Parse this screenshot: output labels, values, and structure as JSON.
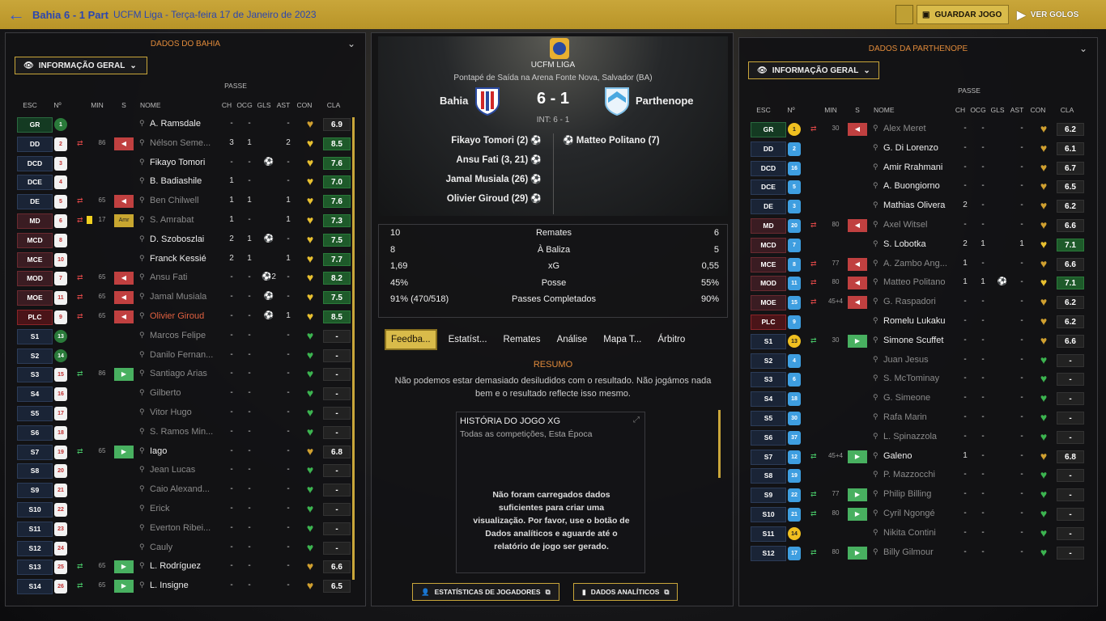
{
  "header": {
    "title": "Bahia 6 - 1 Part",
    "subtitle": "UCFM Liga - Terça-feira 17 de Janeiro de 2023",
    "save_label": "GUARDAR JOGO",
    "watch_label": "VER GOLOS"
  },
  "left": {
    "title": "DADOS DO BAHIA",
    "dropdown": "INFORMAÇÃO GERAL",
    "passe_label": "PASSE",
    "headers": {
      "esc": "ESC",
      "no": "Nº",
      "min": "MIN",
      "s": "S",
      "nome": "NOME",
      "ch": "CH",
      "ocg": "OCG",
      "gls": "GLS",
      "ast": "AST",
      "con": "CON",
      "cla": "CLA"
    },
    "rows": [
      {
        "pos": "GR",
        "no": "1",
        "nm": "A. Ramsdale",
        "ch": "-",
        "ocg": "-",
        "gls": "",
        "ast": "-",
        "cla": "6.9"
      },
      {
        "pos": "DD",
        "no": "2",
        "min": "86",
        "nm": "Nélson Seme...",
        "ch": "3",
        "ocg": "1",
        "gls": "",
        "ast": "2",
        "cla": "8.5"
      },
      {
        "pos": "DCD",
        "no": "3",
        "nm": "Fikayo Tomori",
        "ch": "-",
        "ocg": "-",
        "gls": "⚽",
        "ast": "-",
        "cla": "7.6"
      },
      {
        "pos": "DCE",
        "no": "4",
        "nm": "B. Badiashile",
        "ch": "1",
        "ocg": "-",
        "gls": "",
        "ast": "-",
        "cla": "7.0"
      },
      {
        "pos": "DE",
        "no": "5",
        "min": "65",
        "nm": "Ben Chilwell",
        "ch": "1",
        "ocg": "1",
        "gls": "",
        "ast": "1",
        "cla": "7.6"
      },
      {
        "pos": "MD",
        "no": "6",
        "min": "17",
        "tag": "Amr",
        "nm": "S. Amrabat",
        "ch": "1",
        "ocg": "-",
        "gls": "",
        "ast": "1",
        "cla": "7.3"
      },
      {
        "pos": "MCD",
        "no": "8",
        "nm": "D. Szoboszlai",
        "ch": "2",
        "ocg": "1",
        "gls": "⚽",
        "ast": "-",
        "cla": "7.5"
      },
      {
        "pos": "MCE",
        "no": "10",
        "nm": "Franck Kessié",
        "ch": "2",
        "ocg": "1",
        "gls": "",
        "ast": "1",
        "cla": "7.7"
      },
      {
        "pos": "MOD",
        "no": "7",
        "min": "65",
        "nm": "Ansu Fati",
        "ch": "-",
        "ocg": "-",
        "gls": "⚽2",
        "ast": "-",
        "cla": "8.2"
      },
      {
        "pos": "MOE",
        "no": "11",
        "min": "65",
        "nm": "Jamal Musiala",
        "ch": "-",
        "ocg": "-",
        "gls": "⚽",
        "ast": "-",
        "cla": "7.5"
      },
      {
        "pos": "PLC",
        "no": "9",
        "min": "65",
        "nm": "Olivier Giroud",
        "ch": "-",
        "ocg": "-",
        "gls": "⚽",
        "ast": "1",
        "cla": "8.5"
      },
      {
        "pos": "S1",
        "no": "13",
        "nm": "Marcos Felipe",
        "ch": "-",
        "ocg": "-",
        "gls": "",
        "ast": "-",
        "cla": "-"
      },
      {
        "pos": "S2",
        "no": "14",
        "nm": "Danilo Fernan...",
        "ch": "-",
        "ocg": "-",
        "gls": "",
        "ast": "-",
        "cla": "-"
      },
      {
        "pos": "S3",
        "no": "15",
        "min": "86",
        "nm": "Santiago Arias",
        "ch": "-",
        "ocg": "-",
        "gls": "",
        "ast": "-",
        "cla": "-"
      },
      {
        "pos": "S4",
        "no": "16",
        "nm": "Gilberto",
        "ch": "-",
        "ocg": "-",
        "gls": "",
        "ast": "-",
        "cla": "-"
      },
      {
        "pos": "S5",
        "no": "17",
        "nm": "Vitor Hugo",
        "ch": "-",
        "ocg": "-",
        "gls": "",
        "ast": "-",
        "cla": "-"
      },
      {
        "pos": "S6",
        "no": "18",
        "nm": "S. Ramos Min...",
        "ch": "-",
        "ocg": "-",
        "gls": "",
        "ast": "-",
        "cla": "-"
      },
      {
        "pos": "S7",
        "no": "19",
        "min": "65",
        "nm": "Iago",
        "ch": "-",
        "ocg": "-",
        "gls": "",
        "ast": "-",
        "cla": "6.8"
      },
      {
        "pos": "S8",
        "no": "20",
        "nm": "Jean Lucas",
        "ch": "-",
        "ocg": "-",
        "gls": "",
        "ast": "-",
        "cla": "-"
      },
      {
        "pos": "S9",
        "no": "21",
        "nm": "Caio Alexand...",
        "ch": "-",
        "ocg": "-",
        "gls": "",
        "ast": "-",
        "cla": "-"
      },
      {
        "pos": "S10",
        "no": "22",
        "nm": "Erick",
        "ch": "-",
        "ocg": "-",
        "gls": "",
        "ast": "-",
        "cla": "-"
      },
      {
        "pos": "S11",
        "no": "23",
        "nm": "Everton Ribei...",
        "ch": "-",
        "ocg": "-",
        "gls": "",
        "ast": "-",
        "cla": "-"
      },
      {
        "pos": "S12",
        "no": "24",
        "nm": "Cauly",
        "ch": "-",
        "ocg": "-",
        "gls": "",
        "ast": "-",
        "cla": "-"
      },
      {
        "pos": "S13",
        "no": "25",
        "min": "65",
        "nm": "L. Rodríguez",
        "ch": "-",
        "ocg": "-",
        "gls": "",
        "ast": "-",
        "cla": "6.6"
      },
      {
        "pos": "S14",
        "no": "26",
        "min": "65",
        "nm": "L. Insigne",
        "ch": "-",
        "ocg": "-",
        "gls": "",
        "ast": "-",
        "cla": "6.5"
      }
    ]
  },
  "center": {
    "league": "UCFM LIGA",
    "kickoff": "Pontapé de Saída na Arena Fonte Nova, Salvador (BA)",
    "home": "Bahia",
    "away": "Parthenope",
    "score": "6 - 1",
    "ht": "INT: 6 - 1",
    "home_goals": [
      "Fikayo Tomori (2)",
      "Ansu Fati (3, 21)",
      "Jamal Musiala (26)",
      "Olivier Giroud (29)"
    ],
    "away_goals": [
      "Matteo Politano (7)"
    ],
    "stats": [
      {
        "a": "10",
        "l": "Remates",
        "b": "6"
      },
      {
        "a": "8",
        "l": "À Baliza",
        "b": "5"
      },
      {
        "a": "1,69",
        "l": "xG",
        "b": "0,55"
      },
      {
        "a": "45%",
        "l": "Posse",
        "b": "55%"
      },
      {
        "a": "91% (470/518)",
        "l": "Passes Completados",
        "b": "90%"
      }
    ],
    "tabs": [
      "Feedba...",
      "Estatíst...",
      "Remates",
      "Análise",
      "Mapa T...",
      "Árbitro"
    ],
    "resumo": "RESUMO",
    "feedback": "Não podemos estar demasiado desiludidos com o resultado. Não jogámos nada bem e o resultado reflecte isso mesmo.",
    "xg_title": "HISTÓRIA DO JOGO XG",
    "xg_sub": "Todas as competições, Esta Época",
    "xg_msg": "Não foram carregados dados suficientes para criar uma visualização. Por favor, use o botão de Dados analíticos e aguarde até o relatório de jogo ser gerado.",
    "btn_players": "ESTATÍSTICAS DE JOGADORES",
    "btn_data": "DADOS ANALÍTICOS"
  },
  "right": {
    "title": "DADOS DA PARTHENOPE",
    "dropdown": "INFORMAÇÃO GERAL",
    "passe_label": "PASSE",
    "headers": {
      "esc": "ESC",
      "no": "Nº",
      "min": "MIN",
      "s": "S",
      "nome": "NOME",
      "ch": "CH",
      "ocg": "OCG",
      "gls": "GLS",
      "ast": "AST",
      "con": "CON",
      "cla": "CLA"
    },
    "rows": [
      {
        "pos": "GR",
        "no": "1",
        "min": "30",
        "nm": "Alex Meret",
        "ch": "-",
        "ocg": "-",
        "gls": "",
        "ast": "-",
        "cla": "6.2"
      },
      {
        "pos": "DD",
        "no": "2",
        "nm": "G. Di Lorenzo",
        "ch": "-",
        "ocg": "-",
        "gls": "",
        "ast": "-",
        "cla": "6.1"
      },
      {
        "pos": "DCD",
        "no": "16",
        "nm": "Amir Rrahmani",
        "ch": "-",
        "ocg": "-",
        "gls": "",
        "ast": "-",
        "cla": "6.7"
      },
      {
        "pos": "DCE",
        "no": "5",
        "nm": "A. Buongiorno",
        "ch": "-",
        "ocg": "-",
        "gls": "",
        "ast": "-",
        "cla": "6.5"
      },
      {
        "pos": "DE",
        "no": "3",
        "nm": "Mathias Olivera",
        "ch": "2",
        "ocg": "-",
        "gls": "",
        "ast": "-",
        "cla": "6.2"
      },
      {
        "pos": "MD",
        "no": "20",
        "min": "80",
        "nm": "Axel Witsel",
        "ch": "-",
        "ocg": "-",
        "gls": "",
        "ast": "-",
        "cla": "6.6"
      },
      {
        "pos": "MCD",
        "no": "7",
        "nm": "S. Lobotka",
        "ch": "2",
        "ocg": "1",
        "gls": "",
        "ast": "1",
        "cla": "7.1"
      },
      {
        "pos": "MCE",
        "no": "8",
        "min": "77",
        "nm": "A. Zambo Ang...",
        "ch": "1",
        "ocg": "-",
        "gls": "",
        "ast": "-",
        "cla": "6.6"
      },
      {
        "pos": "MOD",
        "no": "11",
        "min": "80",
        "nm": "Matteo Politano",
        "ch": "1",
        "ocg": "1",
        "gls": "⚽",
        "ast": "-",
        "cla": "7.1"
      },
      {
        "pos": "MOE",
        "no": "15",
        "min": "45+4",
        "nm": "G. Raspadori",
        "ch": "-",
        "ocg": "-",
        "gls": "",
        "ast": "-",
        "cla": "6.2"
      },
      {
        "pos": "PLC",
        "no": "9",
        "nm": "Romelu Lukaku",
        "ch": "-",
        "ocg": "-",
        "gls": "",
        "ast": "-",
        "cla": "6.2"
      },
      {
        "pos": "S1",
        "no": "13",
        "min": "30",
        "nm": "Simone Scuffet",
        "ch": "-",
        "ocg": "-",
        "gls": "",
        "ast": "-",
        "cla": "6.6"
      },
      {
        "pos": "S2",
        "no": "4",
        "nm": "Juan Jesus",
        "ch": "-",
        "ocg": "-",
        "gls": "",
        "ast": "-",
        "cla": "-"
      },
      {
        "pos": "S3",
        "no": "6",
        "nm": "S. McTominay",
        "ch": "-",
        "ocg": "-",
        "gls": "",
        "ast": "-",
        "cla": "-"
      },
      {
        "pos": "S4",
        "no": "18",
        "nm": "G. Simeone",
        "ch": "-",
        "ocg": "-",
        "gls": "",
        "ast": "-",
        "cla": "-"
      },
      {
        "pos": "S5",
        "no": "30",
        "nm": "Rafa Marin",
        "ch": "-",
        "ocg": "-",
        "gls": "",
        "ast": "-",
        "cla": "-"
      },
      {
        "pos": "S6",
        "no": "37",
        "nm": "L. Spinazzola",
        "ch": "-",
        "ocg": "-",
        "gls": "",
        "ast": "-",
        "cla": "-"
      },
      {
        "pos": "S7",
        "no": "12",
        "min": "45+4",
        "nm": "Galeno",
        "ch": "1",
        "ocg": "-",
        "gls": "",
        "ast": "-",
        "cla": "6.8"
      },
      {
        "pos": "S8",
        "no": "19",
        "nm": "P. Mazzocchi",
        "ch": "-",
        "ocg": "-",
        "gls": "",
        "ast": "-",
        "cla": "-"
      },
      {
        "pos": "S9",
        "no": "22",
        "min": "77",
        "nm": "Philip Billing",
        "ch": "-",
        "ocg": "-",
        "gls": "",
        "ast": "-",
        "cla": "-"
      },
      {
        "pos": "S10",
        "no": "21",
        "min": "80",
        "nm": "Cyril Ngongé",
        "ch": "-",
        "ocg": "-",
        "gls": "",
        "ast": "-",
        "cla": "-"
      },
      {
        "pos": "S11",
        "no": "14",
        "nm": "Nikita Contini",
        "ch": "-",
        "ocg": "-",
        "gls": "",
        "ast": "-",
        "cla": "-"
      },
      {
        "pos": "S12",
        "no": "17",
        "min": "80",
        "nm": "Billy Gilmour",
        "ch": "-",
        "ocg": "-",
        "gls": "",
        "ast": "-",
        "cla": "-"
      }
    ]
  },
  "colors": {
    "gold": "#c9a63a",
    "accent_blue": "#2b46b0",
    "orange": "#e08a3a"
  }
}
